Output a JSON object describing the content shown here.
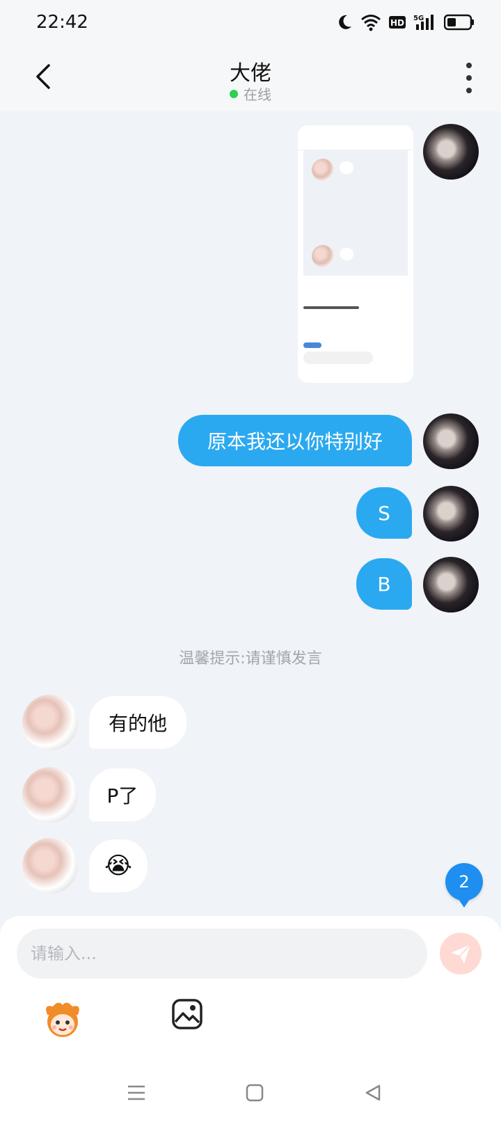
{
  "status_bar": {
    "time": "22:42",
    "icons": [
      "moon-icon",
      "wifi-icon",
      "hd-icon",
      "signal-5g-icon",
      "battery-icon"
    ],
    "hd_label": "HD",
    "network_label": "5G"
  },
  "header": {
    "title": "大佬",
    "presence": "在线",
    "presence_color": "#2bd150"
  },
  "messages": [
    {
      "from": "me",
      "type": "image"
    },
    {
      "from": "me",
      "type": "text",
      "text": "原本我还以你特别好"
    },
    {
      "from": "me",
      "type": "text",
      "text": "S"
    },
    {
      "from": "me",
      "type": "text",
      "text": "B"
    },
    {
      "from": "them",
      "type": "text",
      "text": "有的他"
    },
    {
      "from": "them",
      "type": "text",
      "text": "P了"
    },
    {
      "from": "them",
      "type": "emoji",
      "text": "😭"
    }
  ],
  "tip": "温馨提示:请谨慎发言",
  "unread_badge": "2",
  "composer": {
    "placeholder": "请输入...",
    "send_icon": "send-icon",
    "tools": [
      "mascot-emoji-icon",
      "image-icon"
    ]
  },
  "colors": {
    "my_bubble": "#2ba9f0",
    "their_bubble": "#ffffff",
    "background": "#f0f3f7",
    "badge": "#1e8ff0"
  }
}
